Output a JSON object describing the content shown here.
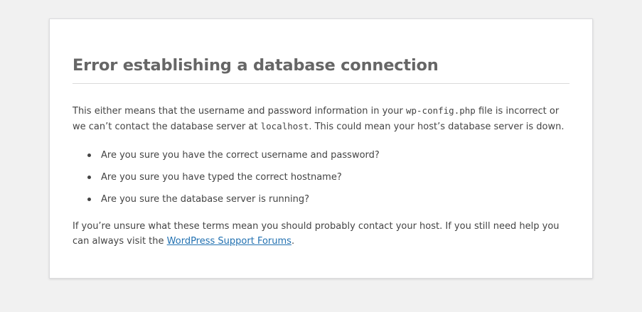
{
  "error": {
    "title": "Error establishing a database connection",
    "intro_part1": "This either means that the username and password information in your ",
    "config_file": "wp-config.php",
    "intro_part2": " file is incorrect or we can’t contact the database server at ",
    "db_host": "localhost",
    "intro_part3": ". This could mean your host’s database server is down.",
    "questions": [
      "Are you sure you have the correct username and password?",
      "Are you sure you have typed the correct hostname?",
      "Are you sure the database server is running?"
    ],
    "help_text": "If you’re unsure what these terms mean you should probably contact your host. If you still need help you can always visit the ",
    "link_text": "WordPress Support Forums",
    "help_end": "."
  },
  "colors": {
    "background": "#f1f1f1",
    "card": "#ffffff",
    "heading": "#666666",
    "text": "#444444",
    "link": "#2271b1"
  }
}
